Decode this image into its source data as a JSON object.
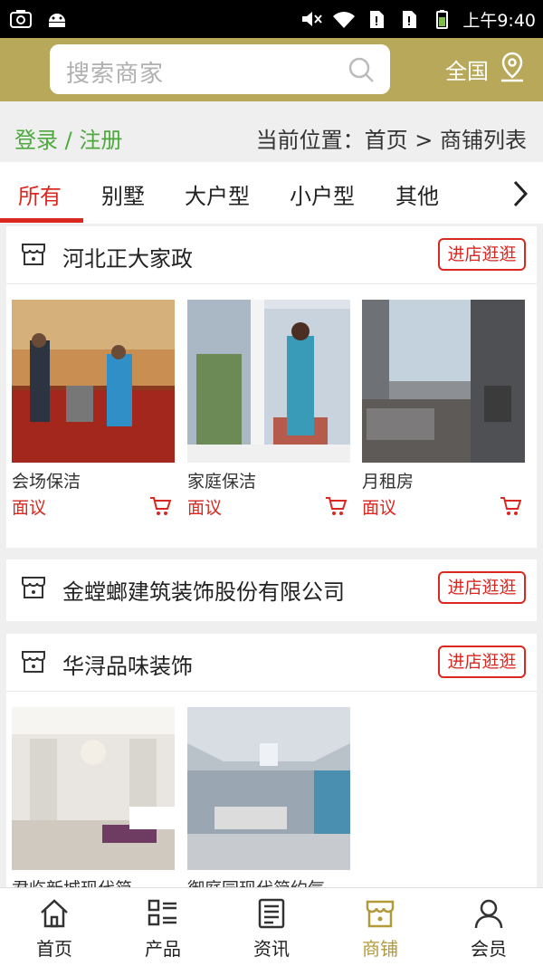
{
  "status_bar": {
    "time": "上午9:40"
  },
  "header": {
    "search_placeholder": "搜索商家",
    "region": "全国"
  },
  "breadcrumb": {
    "login": "登录 / 注册",
    "location": "当前位置：首页 > 商铺列表"
  },
  "tabs": [
    "所有",
    "别墅",
    "大户型",
    "小户型",
    "其他"
  ],
  "active_tab": 0,
  "shops": [
    {
      "name": "河北正大家政",
      "enter_label": "进店逛逛",
      "products": [
        {
          "name": "会场保洁",
          "price": "面议"
        },
        {
          "name": "家庭保洁",
          "price": "面议"
        },
        {
          "name": "月租房",
          "price": "面议"
        }
      ]
    },
    {
      "name": "金螳螂建筑装饰股份有限公司",
      "enter_label": "进店逛逛",
      "products": []
    },
    {
      "name": "华浔品味装饰",
      "enter_label": "进店逛逛",
      "products": [
        {
          "name": "君临新城现代简...",
          "price": ""
        },
        {
          "name": "御庭园现代简约气...",
          "price": ""
        }
      ]
    }
  ],
  "bottom_nav": [
    "首页",
    "产品",
    "资讯",
    "商铺",
    "会员"
  ],
  "active_nav": 3,
  "colors": {
    "header": "#b8a85a",
    "accent_red": "#d8281f",
    "login_green": "#4caa3c",
    "nav_active": "#b29a3a"
  }
}
